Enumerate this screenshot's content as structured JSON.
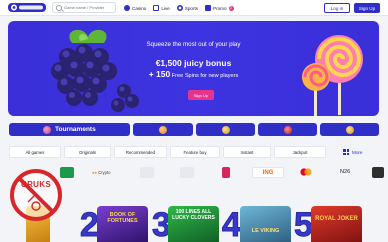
{
  "header": {
    "logo_text": "Casino",
    "search_placeholder": "Game name / Provider",
    "nav": [
      {
        "label": "Casino",
        "icon": "casino-icon"
      },
      {
        "label": "Live",
        "icon": "live-icon"
      },
      {
        "label": "Sports",
        "icon": "sports-icon"
      },
      {
        "label": "Promo",
        "icon": "promo-icon"
      }
    ],
    "promo_badge": "2",
    "login_label": "Log in",
    "signup_label": "Sign Up"
  },
  "hero": {
    "title": "Squeeze the most out of your play",
    "bonus_line": "€1,500 juicy bonus",
    "spins_prefix": "+ 150",
    "spins_text": " Free Spins for new players",
    "cta_label": "Sign Up"
  },
  "tournaments": {
    "title": "Tournaments"
  },
  "categories": [
    "All games",
    "Originals",
    "Recommended",
    "Feature buy",
    "Instant",
    "Jackpot"
  ],
  "more_label": "More",
  "payments": [
    "Crypto",
    "ING",
    "N26"
  ],
  "badge": {
    "text": "CRUKS"
  },
  "games": [
    {
      "rank": "1"
    },
    {
      "rank": "2",
      "title": "BOOK OF FORTUNES"
    },
    {
      "rank": "3",
      "title": "100 LINES ALL LUCKY CLOVERS"
    },
    {
      "rank": "4",
      "title": "LE VIKING"
    },
    {
      "rank": "5",
      "title": "ROYAL JOKER"
    }
  ],
  "colors": {
    "brand": "#2f2fc8",
    "hero_bg": "#3a2fd8",
    "cta_pink": "#e6338d",
    "page_bg": "#f3f4f8"
  }
}
